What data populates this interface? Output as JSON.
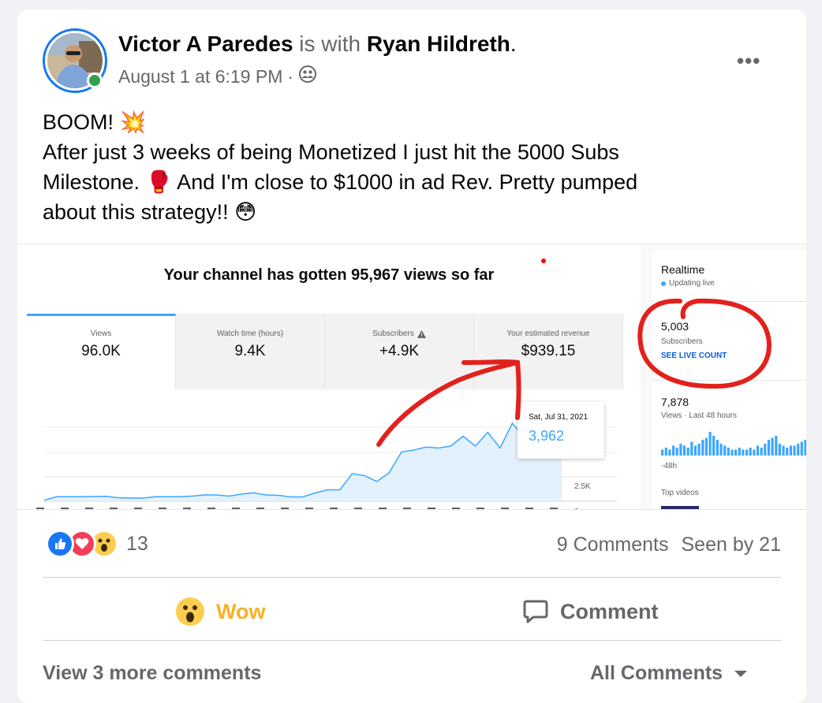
{
  "post": {
    "author": "Victor A Paredes",
    "with_word": "is with",
    "tagged": "Ryan Hildreth",
    "period": ".",
    "date": "August 1 at 6:19 PM",
    "separator": "·",
    "audience_icon": "friends-icon",
    "more_label": "•••",
    "text_lines": [
      "BOOM! 💥",
      "After just 3 weeks of being Monetized I just hit the 5000 Subs",
      "Milestone. 🥊 And I'm close to $1000 in ad Rev.  Pretty pumped",
      "about this strategy!! 😳"
    ]
  },
  "screenshot": {
    "title": "Your channel has gotten 95,967 views so far",
    "metrics": [
      {
        "label": "Views",
        "value": "96.0K"
      },
      {
        "label": "Watch time (hours)",
        "value": "9.4K"
      },
      {
        "label": "Subscribers",
        "value": "+4.9K"
      },
      {
        "label": "Your estimated revenue",
        "value": "$939.15"
      }
    ],
    "tooltip": {
      "date": "Sat, Jul 31, 2021",
      "value": "3,962"
    },
    "y_ticks": [
      "2.5K",
      "0"
    ],
    "realtime": {
      "heading": "Realtime",
      "updating": "Updating live",
      "subs_value": "5,003",
      "subs_label": "Subscribers",
      "live_link": "SEE LIVE COUNT",
      "views_value": "7,878",
      "views_label": "Views · Last 48 hours",
      "axis_label": "-48h",
      "top_videos": "Top videos"
    }
  },
  "chart_data": {
    "type": "area",
    "series": [
      {
        "values": [
          50,
          230,
          230,
          230,
          240,
          250,
          180,
          160,
          160,
          230,
          230,
          230,
          260,
          320,
          320,
          260,
          360,
          430,
          320,
          300,
          220,
          220,
          420,
          580,
          580,
          1400,
          1300,
          1000,
          1450,
          2500,
          2600,
          2750,
          2700,
          2800,
          3300,
          2800,
          3500,
          2700,
          3962,
          3200,
          2600,
          2700,
          3000
        ]
      }
    ],
    "tooltip_point": {
      "x": "Sat, Jul 31, 2021",
      "y": 3962
    },
    "realtime_bars": [
      3,
      4,
      3,
      5,
      4,
      6,
      5,
      4,
      7,
      5,
      6,
      8,
      9,
      12,
      10,
      8,
      6,
      5,
      4,
      3,
      3,
      4,
      3,
      3,
      4,
      3,
      5,
      4,
      6,
      8,
      9,
      10,
      6,
      5,
      4,
      5,
      5,
      6,
      7,
      8
    ]
  },
  "engagement": {
    "reaction_count": "13",
    "comments": "9 Comments",
    "seen_by": "Seen by 21",
    "wow_label": "Wow",
    "comment_label": "Comment",
    "view_more": "View 3 more comments",
    "all_comments": "All Comments"
  },
  "colors": {
    "brand": "#1877f2",
    "wow": "#f7b125",
    "yt_blue": "#3ea6ff",
    "annotation_red": "#e3211c"
  }
}
